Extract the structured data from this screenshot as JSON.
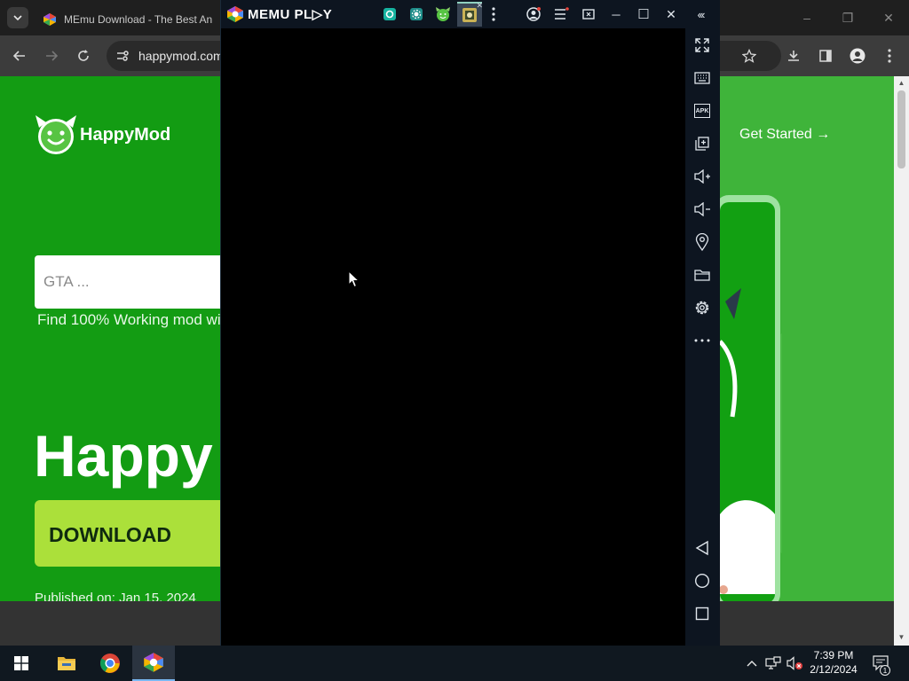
{
  "browser": {
    "tab_title": "MEmu Download - The Best An",
    "url": "happymod.com",
    "window_controls": {
      "minimize": "–",
      "restore": "❐",
      "close": "✕"
    }
  },
  "webpage": {
    "logo_text": "HappyMod",
    "search_placeholder": "GTA ...",
    "tagline": "Find 100% Working mod wi",
    "hero_title": "Happy",
    "download_label": "DOWNLOAD",
    "published": "Published on:  Jan 15, 2024",
    "get_started": "Get Started →",
    "colors": {
      "bg": "#139c13",
      "button": "#abe03a",
      "right_bg": "#3fb43a"
    }
  },
  "memu": {
    "brand": "MEMU PL▷Y",
    "titlebar_icons": [
      "gear-app-icon",
      "settings-app-icon",
      "happymod-app-icon",
      "game-app-icon",
      "kebab-icon",
      "account-icon",
      "menu-icon",
      "screen-cast-icon"
    ],
    "window_controls": {
      "minimize": "─",
      "maximize": "☐",
      "close": "✕",
      "collapse": "‹‹‹"
    },
    "sidebar_labels": {
      "apk": "APK"
    },
    "sidebar_icons": [
      "fullscreen-icon",
      "keyboard-icon",
      "apk-install-icon",
      "multi-instance-icon",
      "volume-up-icon",
      "volume-down-icon",
      "location-icon",
      "folder-icon",
      "settings-icon",
      "more-icon",
      "back-icon",
      "home-icon",
      "recents-icon"
    ]
  },
  "taskbar": {
    "apps": [
      "windows-start-icon",
      "file-explorer-icon",
      "chrome-icon",
      "memu-icon"
    ],
    "time": "7:39 PM",
    "date": "2/12/2024",
    "notification_count": "1"
  }
}
